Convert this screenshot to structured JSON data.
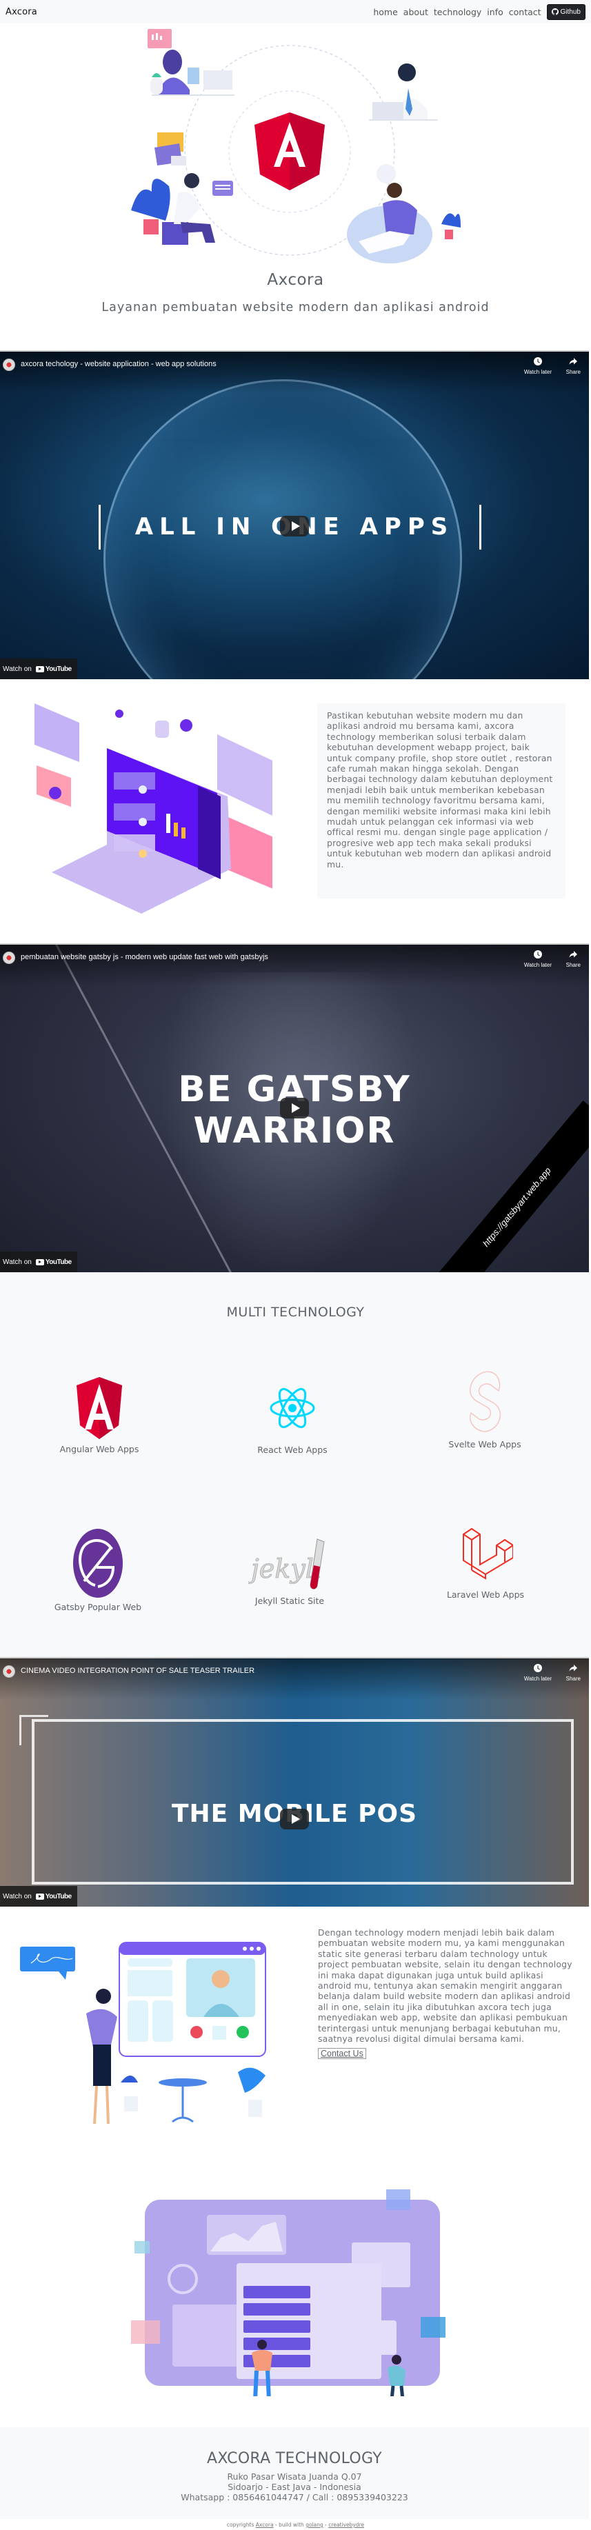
{
  "navbar": {
    "brand": "Axcora",
    "links": [
      {
        "label": "home"
      },
      {
        "label": "about"
      },
      {
        "label": "technology"
      },
      {
        "label": "info"
      },
      {
        "label": "contact"
      }
    ],
    "github_button": {
      "label": "Github",
      "icon": "github-icon"
    }
  },
  "hero": {
    "title": "Axcora",
    "subtitle": "Layanan pembuatan website modern dan aplikasi android",
    "illustration": "team-around-angular-logo"
  },
  "videos": [
    {
      "title": "axcora techology - website application - web app solutions",
      "overlay_text": "ALL IN ONE APPS",
      "watch_later": "Watch later",
      "share": "Share",
      "watch_on": "Watch on",
      "platform": "YouTube"
    },
    {
      "title": "pembuatan website gatsby js - modern web update fast web with gatsbyjs",
      "overlay_text_line1": "BE GATSBY",
      "overlay_text_line2": "WARRIOR",
      "ribbon_text": "https://gatsbyart.web.app",
      "watch_later": "Watch later",
      "share": "Share",
      "watch_on": "Watch on",
      "platform": "YouTube"
    },
    {
      "title": "CINEMA VIDEO INTEGRATION POINT OF SALE TEASER TRAILER",
      "overlay_text": "THE MOBILE POS",
      "watch_later": "Watch later",
      "share": "Share",
      "watch_on": "Watch on",
      "platform": "YouTube"
    }
  ],
  "about": {
    "text": "Pastikan kebutuhan website modern mu dan aplikasi android mu bersama kami, axcora technology memberikan solusi terbaik dalam kebutuhan development webapp project, baik untuk company profile, shop store outlet , restoran cafe rumah makan hingga sekolah. Dengan berbagai technology dalam kebutuhan deployment menjadi lebih baik untuk memberikan kebebasan mu memilih technology favoritmu bersama kami, dengan memiliki website informasi maka kini lebih mudah untuk pelanggan cek informasi via web offical resmi mu. dengan single page application / progresive web app tech maka sekali produksi untuk kebutuhan web modern dan aplikasi android mu."
  },
  "technology": {
    "title": "MULTI TECHNOLOGY",
    "items": [
      {
        "label": "Angular Web Apps",
        "icon": "angular-icon",
        "color": "#c3002f"
      },
      {
        "label": "React Web Apps",
        "icon": "react-icon",
        "color": "#00d8ff"
      },
      {
        "label": "Svelte Web Apps",
        "icon": "svelte-icon",
        "color": "#f5c6c2"
      },
      {
        "label": "Gatsby Popular Web",
        "icon": "gatsby-icon",
        "color": "#663399"
      },
      {
        "label": "Jekyll Static Site",
        "icon": "jekyll-icon",
        "color": "#c2002b"
      },
      {
        "label": "Laravel Web Apps",
        "icon": "laravel-icon",
        "color": "#f22d22"
      }
    ]
  },
  "contact": {
    "text": "Dengan technology modern menjadi lebih baik dalam pembuatan website modern mu, ya kami menggunakan static site generasi terbaru dalam technology untuk project pembuatan website, selain itu dengan technology ini maka dapat digunakan juga untuk build aplikasi android mu, tentunya akan semakin mengirit anggaran belanja dalam build website modern dan aplikasi android all in one, selain itu jika dibutuhkan axcora tech juga menyediakan web app, website dan aplikasi pembukuan terintergasi untuk menunjang berbagai kebutuhan mu, saatnya revolusi digital dimulai bersama kami.",
    "button": "Contact Us"
  },
  "footer": {
    "title": "AXCORA TECHNOLOGY",
    "address_line1": "Ruko Pasar Wisata Juanda Q.07",
    "address_line2": "Sidoarjo - East Java - Indonesia",
    "phones": "Whatsapp : 0856461044747 / Call : 0895339403223",
    "copyright_prefix": "copyrights",
    "copyright_brand": "Axcora",
    "copyright_mid": "- build with",
    "copyright_tech": "golang",
    "copyright_sep": "-",
    "copyright_author": "creativebydre"
  },
  "colors": {
    "navbar_bg": "#f8f9fa",
    "github_btn_bg": "#212529",
    "text_gray": "#5c636a",
    "section_gray": "#f8f9fa",
    "angular_red": "#dd0031",
    "accent_purple": "#6c63ff"
  }
}
